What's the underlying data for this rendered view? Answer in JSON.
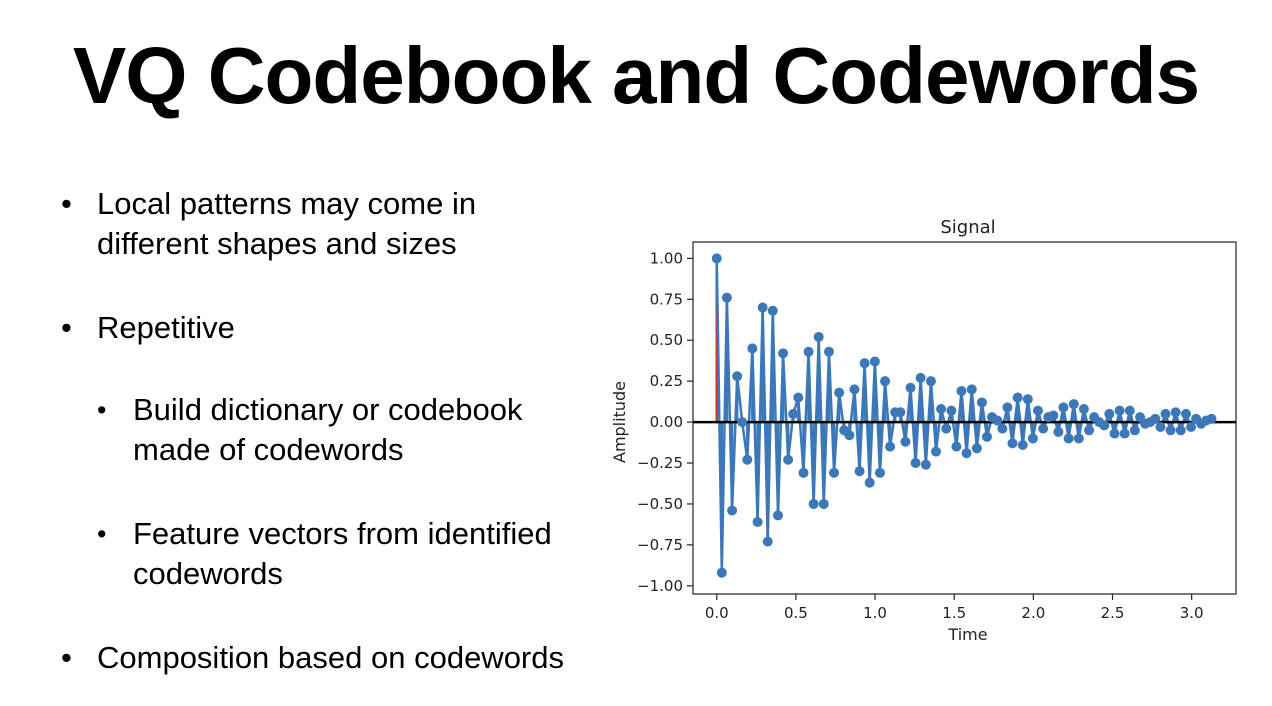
{
  "slide": {
    "title": "VQ Codebook and Codewords",
    "bullets": [
      {
        "text": "Local patterns may come in different shapes and sizes",
        "lines": [
          "Local patterns may come in",
          "different shapes and sizes"
        ]
      },
      {
        "text": "Repetitive",
        "lines": [
          "Repetitive"
        ]
      },
      {
        "text": "Build dictionary or codebook made of codewords",
        "lines": [
          "Build dictionary or codebook",
          "made of codewords"
        ]
      },
      {
        "text": "Feature vectors from identified codewords",
        "lines": [
          "Feature vectors from identified",
          "codewords"
        ]
      },
      {
        "text": "Composition based on codewords",
        "lines": [
          "Composition based on codewords"
        ]
      }
    ],
    "bullet_glyph": "•"
  },
  "chart_data": {
    "type": "stem",
    "title": "Signal",
    "xlabel": "Time",
    "ylabel": "Amplitude",
    "xlim": [
      -0.15,
      3.28
    ],
    "ylim": [
      -1.05,
      1.1
    ],
    "xticks": [
      "0.0",
      "0.5",
      "1.0",
      "1.5",
      "2.0",
      "2.5",
      "3.0"
    ],
    "xtick_values": [
      0.0,
      0.5,
      1.0,
      1.5,
      2.0,
      2.5,
      3.0
    ],
    "yticks": [
      "1.00",
      "0.75",
      "0.50",
      "0.25",
      "0.00",
      "−0.25",
      "−0.50",
      "−0.75",
      "−1.00"
    ],
    "ytick_values": [
      1.0,
      0.75,
      0.5,
      0.25,
      0.0,
      -0.25,
      -0.5,
      -0.75,
      -1.0
    ],
    "baseline": 0.0,
    "colors": {
      "marker": "#3c78b8",
      "stem": "#3c78b8",
      "baseline": "#000000",
      "first_stem": "#cc3333"
    },
    "x": [
      0.0,
      0.032,
      0.064,
      0.097,
      0.129,
      0.161,
      0.193,
      0.225,
      0.258,
      0.29,
      0.322,
      0.354,
      0.387,
      0.419,
      0.451,
      0.483,
      0.515,
      0.548,
      0.58,
      0.612,
      0.644,
      0.676,
      0.709,
      0.741,
      0.773,
      0.805,
      0.838,
      0.87,
      0.902,
      0.934,
      0.966,
      0.999,
      1.031,
      1.063,
      1.095,
      1.127,
      1.16,
      1.192,
      1.224,
      1.256,
      1.288,
      1.321,
      1.353,
      1.385,
      1.417,
      1.45,
      1.482,
      1.514,
      1.546,
      1.578,
      1.611,
      1.643,
      1.675,
      1.707,
      1.739,
      1.772,
      1.804,
      1.836,
      1.868,
      1.901,
      1.933,
      1.965,
      1.997,
      2.029,
      2.062,
      2.094,
      2.126,
      2.158,
      2.19,
      2.223,
      2.255,
      2.287,
      2.319,
      2.352,
      2.384,
      2.416,
      2.448,
      2.48,
      2.513,
      2.545,
      2.577,
      2.609,
      2.641,
      2.674,
      2.706,
      2.738,
      2.77,
      2.803,
      2.835,
      2.867,
      2.899,
      2.931,
      2.964,
      2.996,
      3.028,
      3.06,
      3.092,
      3.125
    ],
    "y": [
      1.0,
      -0.92,
      0.76,
      -0.54,
      0.28,
      0.0,
      -0.23,
      0.45,
      -0.61,
      0.7,
      -0.73,
      0.68,
      -0.57,
      0.42,
      -0.23,
      0.05,
      0.15,
      -0.31,
      0.43,
      -0.5,
      0.52,
      -0.5,
      0.43,
      -0.31,
      0.18,
      -0.05,
      -0.08,
      0.2,
      -0.3,
      0.36,
      -0.37,
      0.37,
      -0.31,
      0.25,
      -0.15,
      0.06,
      0.06,
      -0.12,
      0.21,
      -0.25,
      0.27,
      -0.26,
      0.25,
      -0.18,
      0.08,
      -0.04,
      0.07,
      -0.15,
      0.19,
      -0.19,
      0.2,
      -0.16,
      0.12,
      -0.09,
      0.03,
      0.01,
      -0.04,
      0.09,
      -0.13,
      0.15,
      -0.14,
      0.14,
      -0.1,
      0.07,
      -0.04,
      0.03,
      0.04,
      -0.06,
      0.09,
      -0.1,
      0.11,
      -0.1,
      0.08,
      -0.05,
      0.03,
      0.0,
      -0.02,
      0.05,
      -0.07,
      0.07,
      -0.07,
      0.07,
      -0.05,
      0.03,
      -0.01,
      0.0,
      0.02,
      -0.03,
      0.05,
      -0.05,
      0.06,
      -0.05,
      0.05,
      -0.03,
      0.02,
      -0.01,
      0.01,
      0.02
    ]
  }
}
